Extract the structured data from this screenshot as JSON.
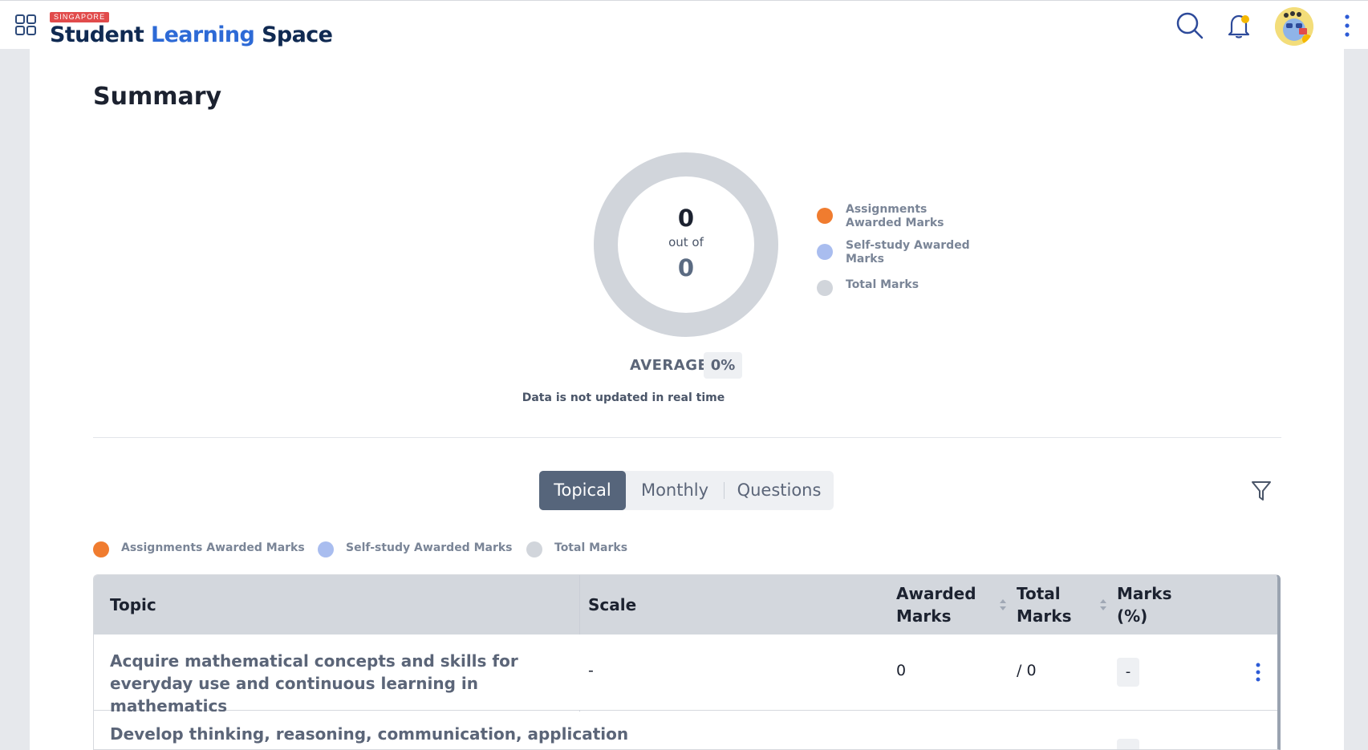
{
  "header": {
    "logo_tag": "SINGAPORE",
    "logo_word1": "Student",
    "logo_word2": "Learning",
    "logo_word3": "Space",
    "icons": [
      "apps-grid-icon",
      "search-icon",
      "bell-icon",
      "avatar",
      "more-vertical-icon"
    ]
  },
  "summary": {
    "title": "Summary",
    "awarded_value": "0",
    "out_of_label": "out of",
    "total_value": "0",
    "legend": [
      {
        "label": "Assignments Awarded Marks",
        "color": "#f07c2f"
      },
      {
        "label": "Self-study Awarded Marks",
        "color": "#a9bdef"
      },
      {
        "label": "Total Marks",
        "color": "#d1d5db"
      }
    ],
    "average_label": "AVERAGE",
    "average_value": "0%",
    "data_note": "Data is not updated in real time"
  },
  "tabs": [
    {
      "label": "Topical",
      "active": true
    },
    {
      "label": "Monthly",
      "active": false
    },
    {
      "label": "Questions",
      "active": false
    }
  ],
  "table": {
    "columns": [
      "Topic",
      "Scale",
      "Awarded Marks",
      "Total Marks",
      "Marks (%)"
    ],
    "rows": [
      {
        "topic": "Acquire mathematical concepts and skills for everyday use and continuous learning in mathematics",
        "scale": "-",
        "awarded": "0",
        "total": "/ 0",
        "pct": "-"
      },
      {
        "topic": "Develop thinking, reasoning, communication, application",
        "scale": "",
        "awarded": "",
        "total": "",
        "pct": ""
      }
    ]
  },
  "colors": {
    "accent_dark": "#56657b",
    "assignments": "#f07c2f",
    "self_study": "#a9bdef",
    "total": "#d1d5db",
    "link_blue": "#2d5bd6"
  }
}
